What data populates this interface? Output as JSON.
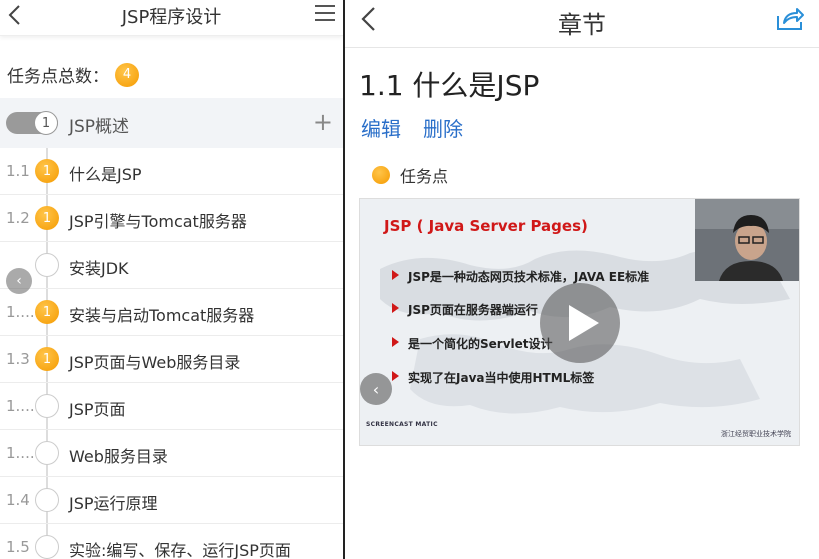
{
  "left": {
    "title": "JSP程序设计",
    "task_total_label": "任务点总数：",
    "task_total_count": "4",
    "chapter": {
      "num": "1",
      "label": "JSP概述"
    },
    "items": [
      {
        "num": "1.1",
        "badge": "1",
        "label": "什么是JSP",
        "active": true
      },
      {
        "num": "1.2",
        "badge": "1",
        "label": "JSP引擎与Tomcat服务器",
        "active": true
      },
      {
        "num": "",
        "badge": "",
        "label": "安装JDK",
        "active": false
      },
      {
        "num": "1....",
        "badge": "1",
        "label": "安装与启动Tomcat服务器",
        "active": true
      },
      {
        "num": "1.3",
        "badge": "1",
        "label": "JSP页面与Web服务目录",
        "active": true
      },
      {
        "num": "1....",
        "badge": "",
        "label": "JSP页面",
        "active": false
      },
      {
        "num": "1....",
        "badge": "",
        "label": "Web服务目录",
        "active": false
      },
      {
        "num": "1.4",
        "badge": "",
        "label": "JSP运行原理",
        "active": false
      },
      {
        "num": "1.5",
        "badge": "",
        "label": "实验:编写、保存、运行JSP页面",
        "active": false
      }
    ]
  },
  "right": {
    "title": "章节",
    "section_title": "1.1 什么是JSP",
    "actions": {
      "edit": "编辑",
      "delete": "删除"
    },
    "task_point": "任务点",
    "video": {
      "slide_title": "JSP ( Java Server Pages)",
      "bullets": [
        "JSP是一种动态网页技术标准，JAVA EE标准",
        "JSP页面在服务器端运行",
        "是一个简化的Servlet设计",
        "实现了在Java当中使用HTML标签"
      ],
      "watermark_left": "SCREENCAST MATIC",
      "watermark_right": "浙江经贸职业技术学院"
    }
  },
  "colors": {
    "accent": "#2a6fc9",
    "badge": "#f59a00",
    "slide_title": "#d01818"
  }
}
